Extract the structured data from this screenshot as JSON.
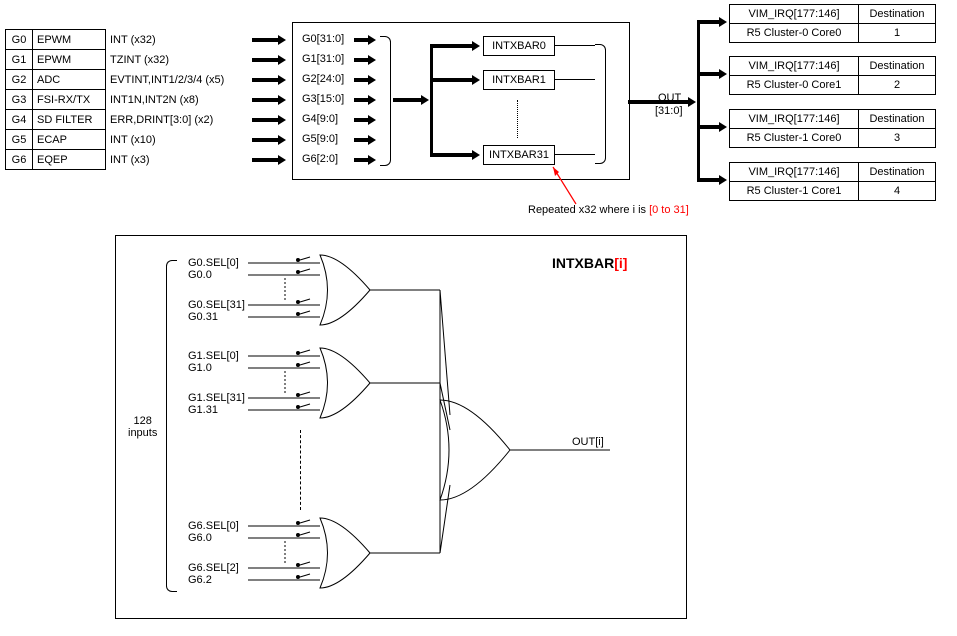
{
  "groups": [
    {
      "id": "G0",
      "name": "EPWM",
      "sig": "INT (x32)",
      "bits": "G0[31:0]"
    },
    {
      "id": "G1",
      "name": "EPWM",
      "sig": "TZINT (x32)",
      "bits": "G1[31:0]"
    },
    {
      "id": "G2",
      "name": "ADC",
      "sig": "EVTINT,INT1/2/3/4 (x5)",
      "bits": "G2[24:0]"
    },
    {
      "id": "G3",
      "name": "FSI-RX/TX",
      "sig": "INT1N,INT2N (x8)",
      "bits": "G3[15:0]"
    },
    {
      "id": "G4",
      "name": "SD FILTER",
      "sig": "ERR,DRINT[3:0] (x2)",
      "bits": "G4[9:0]"
    },
    {
      "id": "G5",
      "name": "ECAP",
      "sig": "INT (x10)",
      "bits": "G5[9:0]"
    },
    {
      "id": "G6",
      "name": "EQEP",
      "sig": "INT (x3)",
      "bits": "G6[2:0]"
    }
  ],
  "xbars": [
    "INTXBAR0",
    "INTXBAR1",
    "INTXBAR31"
  ],
  "out_label": "OUT",
  "out_bits": "[31:0]",
  "dest_header": "VIM_IRQ[177:146]",
  "dest_col": "Destination",
  "destinations": [
    {
      "name": "R5 Cluster-0 Core0",
      "id": "1"
    },
    {
      "name": "R5 Cluster-0 Core1",
      "id": "2"
    },
    {
      "name": "R5 Cluster-1 Core0",
      "id": "3"
    },
    {
      "name": "R5 Cluster-1 Core1",
      "id": "4"
    }
  ],
  "repeat_text_a": "Repeated x32 where i is ",
  "repeat_text_b": "[0 to 31]",
  "detail_title_a": "INTXBAR",
  "detail_title_b": "[i]",
  "inputs_count": "128",
  "inputs_word": "inputs",
  "sel_labels": [
    [
      "G0.SEL[0]",
      "G0.0",
      "G0.SEL[31]",
      "G0.31"
    ],
    [
      "G1.SEL[0]",
      "G1.0",
      "G1.SEL[31]",
      "G1.31"
    ],
    [
      "G6.SEL[0]",
      "G6.0",
      "G6.SEL[2]",
      "G6.2"
    ]
  ],
  "out_i": "OUT[i]"
}
